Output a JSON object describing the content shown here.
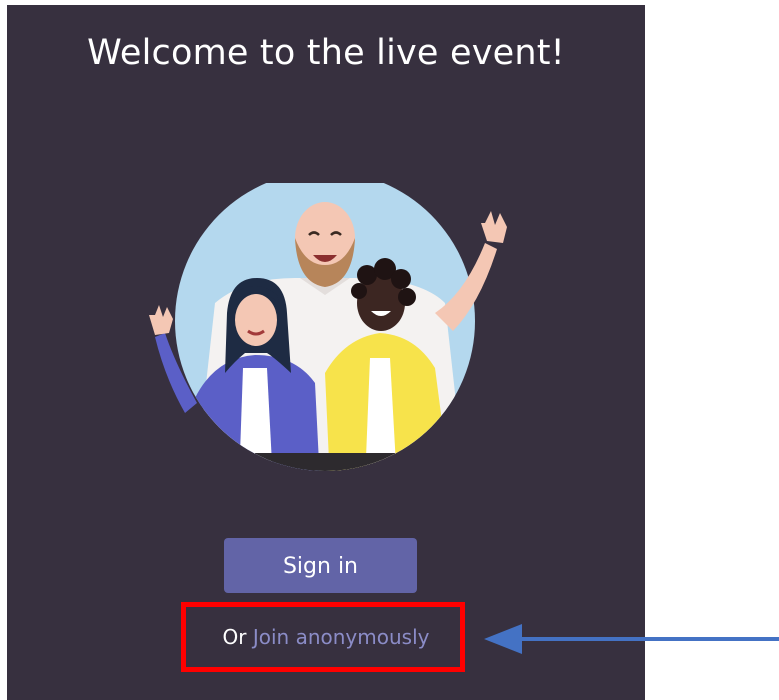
{
  "panel": {
    "title": "Welcome to the live event!",
    "background": "#37303f"
  },
  "illustration": {
    "icon": "people-waving-illustration"
  },
  "signin": {
    "label": "Sign in",
    "color": "#6264a7"
  },
  "anonymous": {
    "prefix": "Or",
    "link_label": "Join anonymously",
    "link_color": "#8b8cc7"
  },
  "annotation": {
    "box_color": "#ff0000",
    "arrow_color": "#4472c4",
    "arrow_icon": "arrow-left-icon"
  }
}
